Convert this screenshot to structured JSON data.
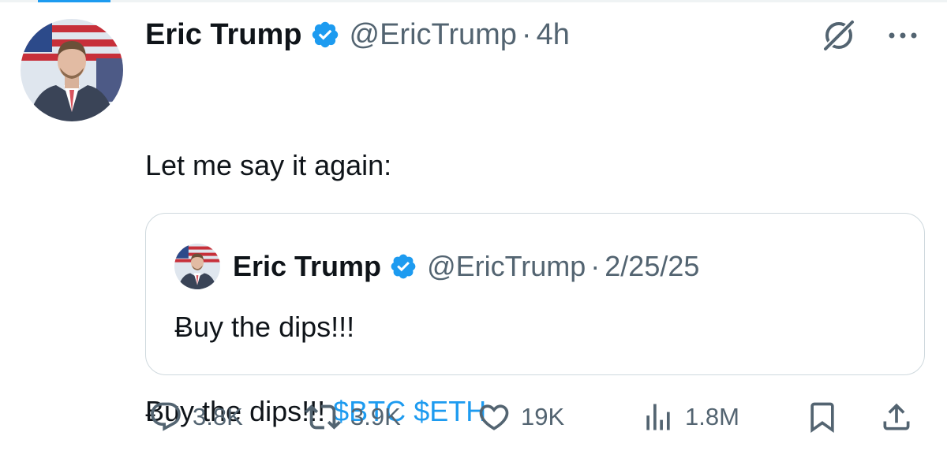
{
  "tweet": {
    "author_name": "Eric Trump",
    "handle": "@EricTrump",
    "separator": "·",
    "time": "4h",
    "text_line1": "Let me say it again:",
    "text_line3_prefix": "Ƀuy the dips!!! ",
    "cashtag_1": "$BTC",
    "cashtag_2": "$ETH"
  },
  "quoted_tweet": {
    "author_name": "Eric Trump",
    "handle": "@EricTrump",
    "separator": "·",
    "date": "2/25/25",
    "text": "Ƀuy the dips!!!"
  },
  "actions": {
    "replies": "3.8K",
    "reposts": "3.9K",
    "likes": "19K",
    "views": "1.8M"
  },
  "colors": {
    "accent": "#1d9bf0",
    "text": "#0f1419",
    "muted": "#536471",
    "border": "#cfd9de"
  },
  "icons": [
    "grok-icon",
    "more-icon",
    "verified-badge-icon",
    "reply-icon",
    "repost-icon",
    "like-icon",
    "views-icon",
    "bookmark-icon",
    "share-icon"
  ]
}
